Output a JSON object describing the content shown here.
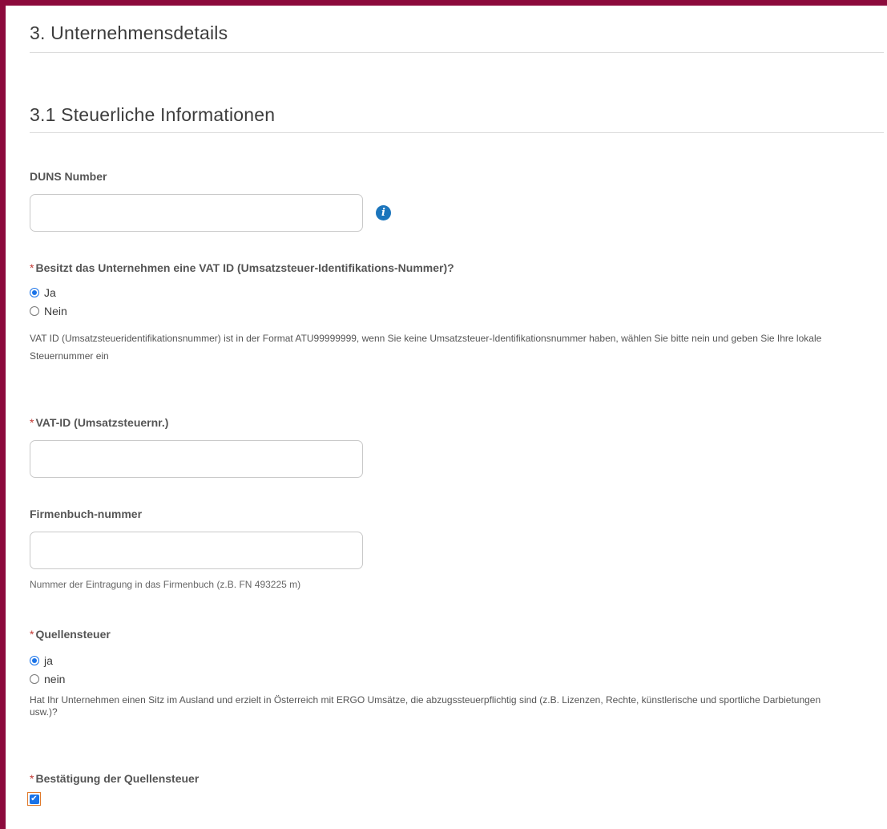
{
  "section": {
    "title": "3. Unternehmensdetails",
    "subsection_title": "3.1 Steuerliche Informationen"
  },
  "duns": {
    "label": "DUNS Number",
    "value": "",
    "info_icon": "info-icon"
  },
  "vat_question": {
    "required_marker": "*",
    "label": "Besitzt das Unternehmen eine VAT ID (Umsatzsteuer-Identifikations-Nummer)?",
    "options": [
      {
        "label": "Ja",
        "checked": true
      },
      {
        "label": "Nein",
        "checked": false
      }
    ],
    "help": "VAT ID (Umsatzsteueridentifikationsnummer) ist in der Format ATU99999999, wenn Sie keine Umsatzsteuer-Identifikationsnummer haben, wählen Sie bitte nein und geben Sie Ihre lokale Steuernummer ein"
  },
  "vat_id": {
    "required_marker": "*",
    "label": "VAT-ID (Umsatzsteuernr.)",
    "value": ""
  },
  "firmenbuch": {
    "label": "Firmenbuch-nummer",
    "value": "",
    "help": "Nummer der Eintragung in das Firmenbuch (z.B. FN 493225 m)"
  },
  "quellensteuer": {
    "required_marker": "*",
    "label": "Quellensteuer",
    "options": [
      {
        "label": "ja",
        "checked": true
      },
      {
        "label": "nein",
        "checked": false
      }
    ],
    "help": "Hat Ihr Unternehmen einen Sitz im Ausland und erzielt in Österreich mit ERGO Umsätze, die abzugssteuerpflichtig sind (z.B. Lizenzen, Rechte, künstlerische und sportliche Darbietungen usw.)?"
  },
  "bestaetigung": {
    "required_marker": "*",
    "label": "Bestätigung der Quellensteuer",
    "checked": true,
    "check_glyph": "✔"
  },
  "colors": {
    "frame": "#8c0a3c",
    "accent": "#1a73e8",
    "required": "#c23934",
    "focus": "#e07a2c"
  }
}
